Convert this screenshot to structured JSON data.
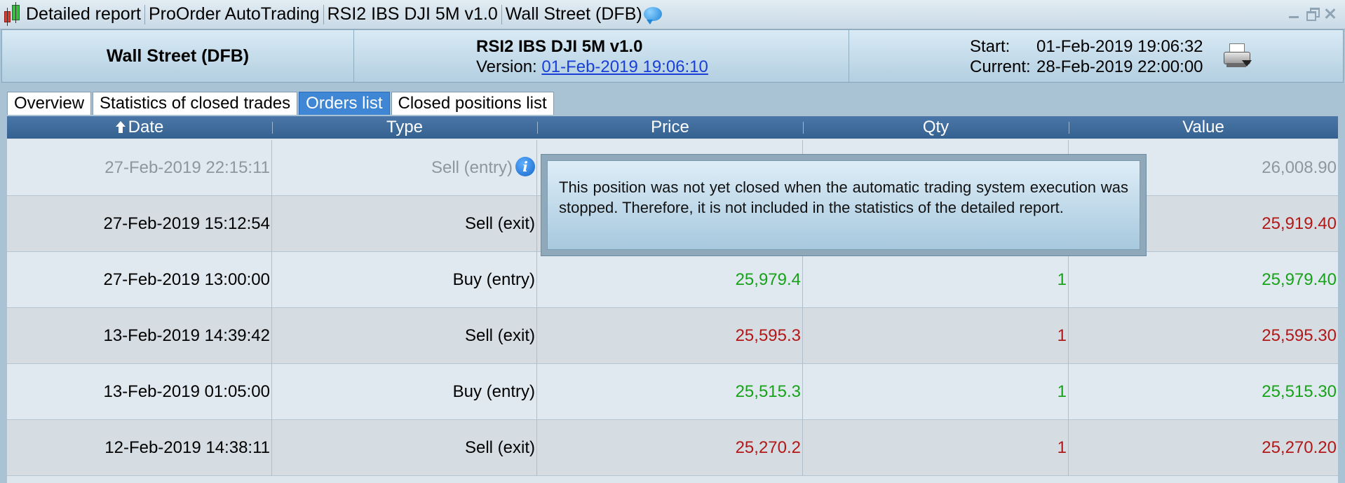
{
  "window": {
    "title_segments": [
      "Detailed report",
      "ProOrder AutoTrading",
      "RSI2 IBS DJI 5M v1.0",
      "Wall Street (DFB)"
    ],
    "icons": [
      "candlestick-chart-icon",
      "chat-bubble-icon",
      "minimize-icon",
      "restore-icon",
      "close-icon"
    ]
  },
  "header": {
    "market": "Wall Street (DFB)",
    "system_name": "RSI2 IBS DJI 5M v1.0",
    "version_label": "Version:",
    "version_link": "01-Feb-2019 19:06:10",
    "start_label": "Start:",
    "start_value": "01-Feb-2019 19:06:32",
    "current_label": "Current:",
    "current_value": "28-Feb-2019 22:00:00"
  },
  "tabs": [
    {
      "label": "Overview",
      "active": false
    },
    {
      "label": "Statistics of closed trades",
      "active": false
    },
    {
      "label": "Orders list",
      "active": true
    },
    {
      "label": "Closed positions list",
      "active": false
    }
  ],
  "table": {
    "columns": [
      "Date",
      "Type",
      "Price",
      "Qty",
      "Value"
    ],
    "sort_column": "Date",
    "rows": [
      {
        "date": "27-Feb-2019 22:15:11",
        "type": "Sell (entry)",
        "price": "",
        "qty": "",
        "value": "26,008.90",
        "style": "faded",
        "info": true
      },
      {
        "date": "27-Feb-2019 15:12:54",
        "type": "Sell (exit)",
        "price": "",
        "qty": "",
        "value": "25,919.40",
        "style": "neg",
        "info": false
      },
      {
        "date": "27-Feb-2019 13:00:00",
        "type": "Buy (entry)",
        "price": "25,979.4",
        "qty": "1",
        "value": "25,979.40",
        "style": "pos",
        "info": false
      },
      {
        "date": "13-Feb-2019 14:39:42",
        "type": "Sell (exit)",
        "price": "25,595.3",
        "qty": "1",
        "value": "25,595.30",
        "style": "neg",
        "info": false
      },
      {
        "date": "13-Feb-2019 01:05:00",
        "type": "Buy (entry)",
        "price": "25,515.3",
        "qty": "1",
        "value": "25,515.30",
        "style": "pos",
        "info": false
      },
      {
        "date": "12-Feb-2019 14:38:11",
        "type": "Sell (exit)",
        "price": "25,270.2",
        "qty": "1",
        "value": "25,270.20",
        "style": "neg",
        "info": false
      }
    ]
  },
  "tooltip": {
    "text": "This position was not yet closed when the automatic trading system execution was stopped. Therefore, it is not included in the statistics of the detailed report."
  },
  "colors": {
    "positive": "#17a21a",
    "negative": "#b21818",
    "faded": "#8e979e",
    "active_tab": "#3f86d4",
    "table_header": "#34618f"
  }
}
